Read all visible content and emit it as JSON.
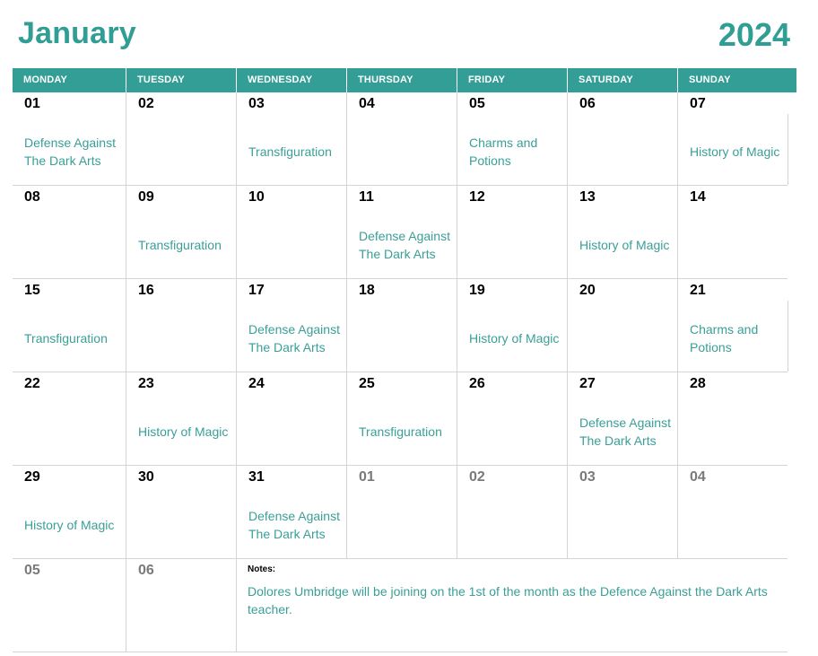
{
  "header": {
    "month": "January",
    "year": "2024"
  },
  "weekdays": [
    "MONDAY",
    "TUESDAY",
    "WEDNESDAY",
    "THURSDAY",
    "FRIDAY",
    "SATURDAY",
    "SUNDAY"
  ],
  "colors": {
    "accent": "#339e95",
    "event_text": "#3a9f97",
    "other_month": "#7a7a7a",
    "grid_line": "#d4d4d4"
  },
  "weeks": [
    [
      {
        "day": "01",
        "event": "Defense Against The Dark Arts"
      },
      {
        "day": "02",
        "event": ""
      },
      {
        "day": "03",
        "event": "Transfiguration"
      },
      {
        "day": "04",
        "event": ""
      },
      {
        "day": "05",
        "event": "Charms and Potions"
      },
      {
        "day": "06",
        "event": ""
      },
      {
        "day": "07",
        "event": "History of Magic"
      }
    ],
    [
      {
        "day": "08",
        "event": ""
      },
      {
        "day": "09",
        "event": "Transfiguration"
      },
      {
        "day": "10",
        "event": ""
      },
      {
        "day": "11",
        "event": "Defense Against The Dark Arts"
      },
      {
        "day": "12",
        "event": ""
      },
      {
        "day": "13",
        "event": "History of Magic"
      },
      {
        "day": "14",
        "event": ""
      }
    ],
    [
      {
        "day": "15",
        "event": "Transfiguration"
      },
      {
        "day": "16",
        "event": ""
      },
      {
        "day": "17",
        "event": "Defense Against The Dark Arts"
      },
      {
        "day": "18",
        "event": ""
      },
      {
        "day": "19",
        "event": "History of Magic"
      },
      {
        "day": "20",
        "event": ""
      },
      {
        "day": "21",
        "event": "Charms and Potions"
      }
    ],
    [
      {
        "day": "22",
        "event": ""
      },
      {
        "day": "23",
        "event": "History of Magic"
      },
      {
        "day": "24",
        "event": ""
      },
      {
        "day": "25",
        "event": "Transfiguration"
      },
      {
        "day": "26",
        "event": ""
      },
      {
        "day": "27",
        "event": "Defense Against The Dark Arts"
      },
      {
        "day": "28",
        "event": ""
      }
    ],
    [
      {
        "day": "29",
        "event": "History of Magic"
      },
      {
        "day": "30",
        "event": ""
      },
      {
        "day": "31",
        "event": "Defense Against The Dark Arts"
      },
      {
        "day": "01",
        "event": "",
        "other": true
      },
      {
        "day": "02",
        "event": "",
        "other": true
      },
      {
        "day": "03",
        "event": "",
        "other": true
      },
      {
        "day": "04",
        "event": "",
        "other": true
      }
    ],
    [
      {
        "day": "05",
        "event": "",
        "other": true
      },
      {
        "day": "06",
        "event": "",
        "other": true
      }
    ]
  ],
  "notes": {
    "label": "Notes:",
    "text": "Dolores Umbridge will be joining on the 1st of the month as the Defence Against the Dark Arts teacher."
  }
}
